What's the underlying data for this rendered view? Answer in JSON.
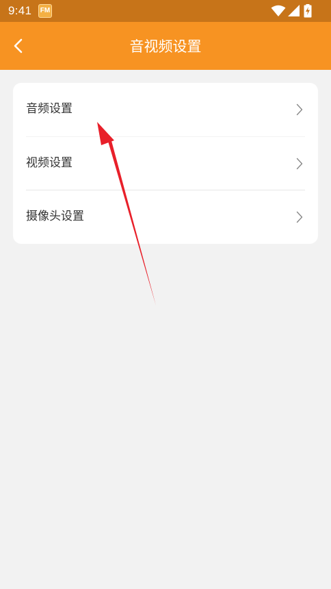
{
  "status_bar": {
    "time": "9:41",
    "app_icon_text": "FM",
    "icons": [
      "wifi-icon",
      "signal-icon",
      "battery-charging-icon"
    ]
  },
  "app_bar": {
    "title": "音视频设置",
    "back_icon": "chevron-left-icon"
  },
  "settings": {
    "items": [
      {
        "label": "音频设置",
        "icon": "chevron-right-icon"
      },
      {
        "label": "视频设置",
        "icon": "chevron-right-icon"
      },
      {
        "label": "摄像头设置",
        "icon": "chevron-right-icon"
      }
    ]
  },
  "colors": {
    "status_bar": "#c77419",
    "app_bar": "#f79322",
    "background": "#f2f2f2",
    "card": "#ffffff",
    "annotation_arrow": "#e8202a"
  }
}
